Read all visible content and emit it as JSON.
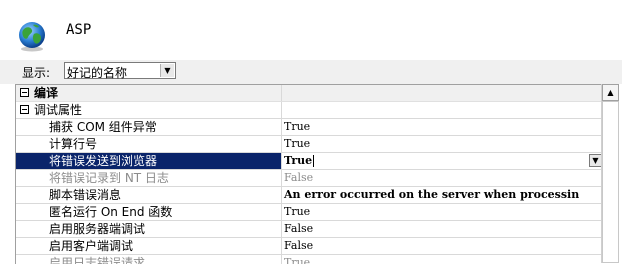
{
  "header": {
    "icon": "globe-icon",
    "title": "ASP"
  },
  "toolbar": {
    "show_label": "显示:",
    "display_select": {
      "value": "好记的名称",
      "icon": "dropdown-arrow-icon"
    }
  },
  "grid": {
    "sections": [
      {
        "label": "编译"
      },
      {
        "label": "调试属性"
      }
    ],
    "rows": [
      {
        "name": "捕获 COM 组件异常",
        "value": "True"
      },
      {
        "name": "计算行号",
        "value": "True"
      },
      {
        "name": "将错误发送到浏览器",
        "value": "True"
      },
      {
        "name": "将错误记录到 NT 日志",
        "value": "False"
      },
      {
        "name": "脚本错误消息",
        "value": "An error occurred on the server when processin"
      },
      {
        "name": "匿名运行 On End 函数",
        "value": "True"
      },
      {
        "name": "启用服务器端调试",
        "value": "False"
      },
      {
        "name": "启用客户端调试",
        "value": "False"
      },
      {
        "name": "启用日志错误请求",
        "value": "True"
      }
    ]
  },
  "colors": {
    "selection": "#0a246a",
    "section_background": "#f0f0f0",
    "disabled_text": "#8c8c8c"
  }
}
